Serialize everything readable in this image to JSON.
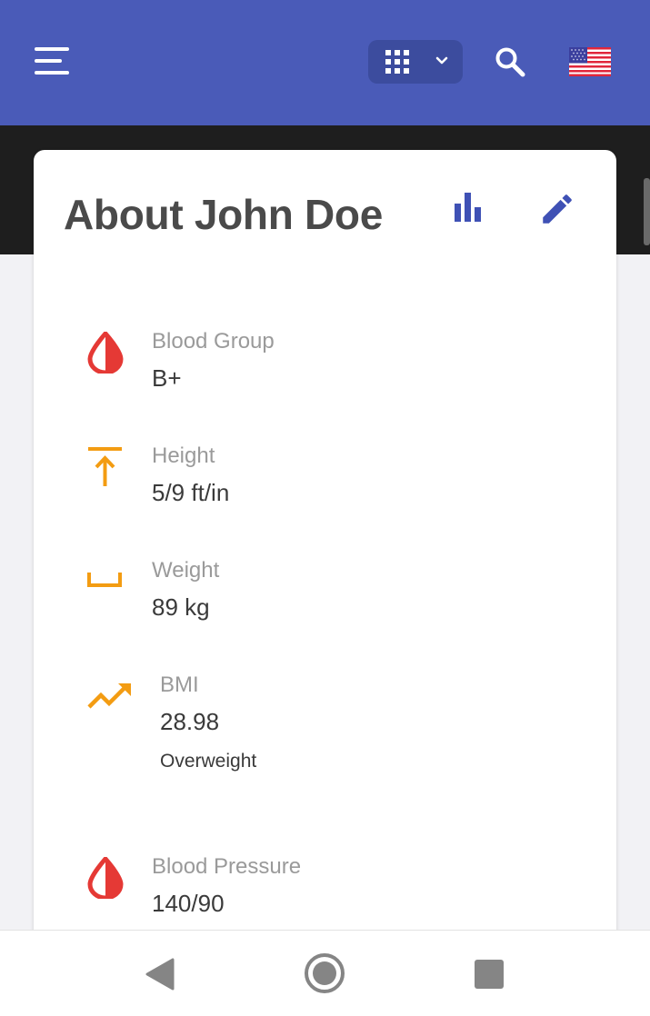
{
  "appbar": {
    "menu_icon": "hamburger-menu-icon",
    "apps_icon": "apps-grid-icon",
    "search_icon": "search-icon",
    "flag_icon": "us-flag-icon",
    "color": "#4a5bb8"
  },
  "card": {
    "title": "About John Doe",
    "stats_icon": "bar-chart-icon",
    "edit_icon": "pencil-edit-icon",
    "accent": "#3f51b5"
  },
  "metrics": {
    "blood_group": {
      "label": "Blood Group",
      "value": "B+",
      "icon": "blood-drop-icon"
    },
    "height": {
      "label": "Height",
      "value": "5/9 ft/in",
      "icon": "height-arrow-icon"
    },
    "weight": {
      "label": "Weight",
      "value": "89 kg",
      "icon": "weight-scale-icon"
    },
    "bmi": {
      "label": "BMI",
      "value": "28.98",
      "status": "Overweight",
      "icon": "trending-up-icon"
    },
    "blood_pressure": {
      "label": "Blood Pressure",
      "value": "140/90",
      "icon": "blood-drop-icon"
    }
  },
  "colors": {
    "red": "#e53935",
    "orange": "#f39c12"
  },
  "navbar": {
    "back_icon": "back-triangle-icon",
    "home_icon": "home-circle-icon",
    "recent_icon": "recent-apps-square-icon"
  }
}
